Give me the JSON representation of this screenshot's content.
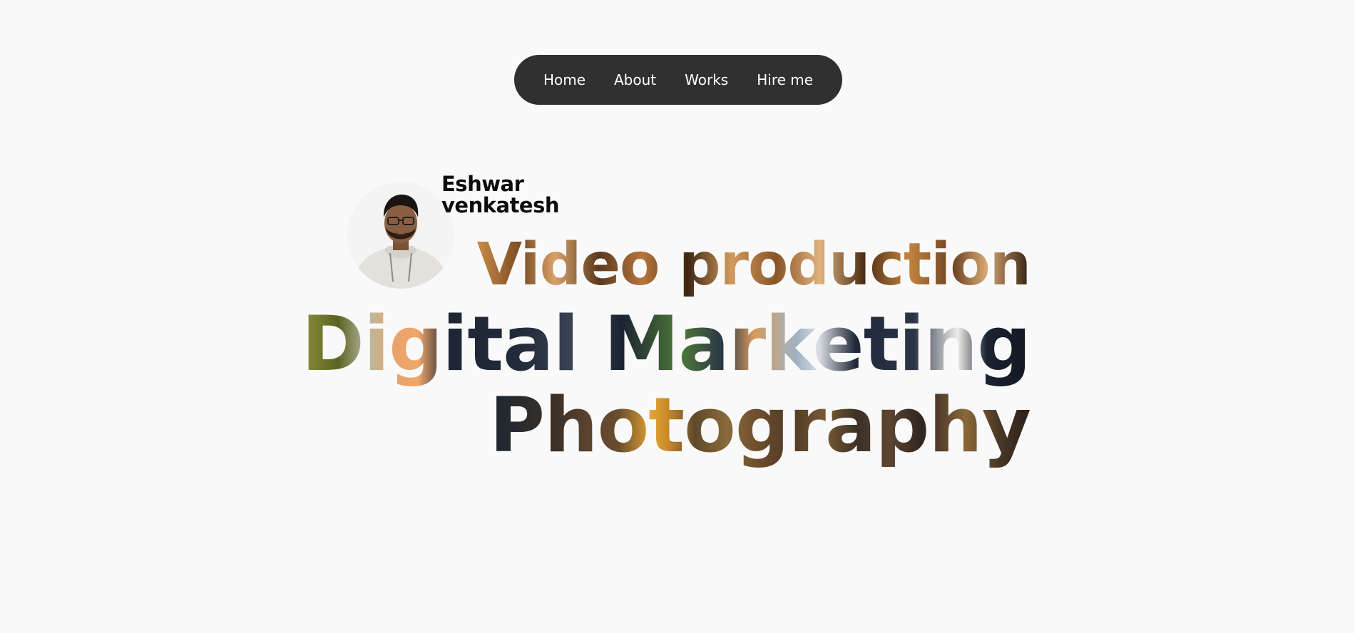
{
  "nav": {
    "items": [
      {
        "label": "Home"
      },
      {
        "label": "About"
      },
      {
        "label": "Works"
      },
      {
        "label": "Hire me"
      }
    ]
  },
  "profile": {
    "first_name": "Eshwar",
    "last_name": "venkatesh"
  },
  "headlines": {
    "line1": "Video production",
    "line2": "Digital Marketing",
    "line3": "Photography"
  },
  "colors": {
    "background": "#f9f9f9",
    "nav_background": "#303030",
    "nav_text": "#ffffff",
    "name_text": "#0d0d0d"
  }
}
